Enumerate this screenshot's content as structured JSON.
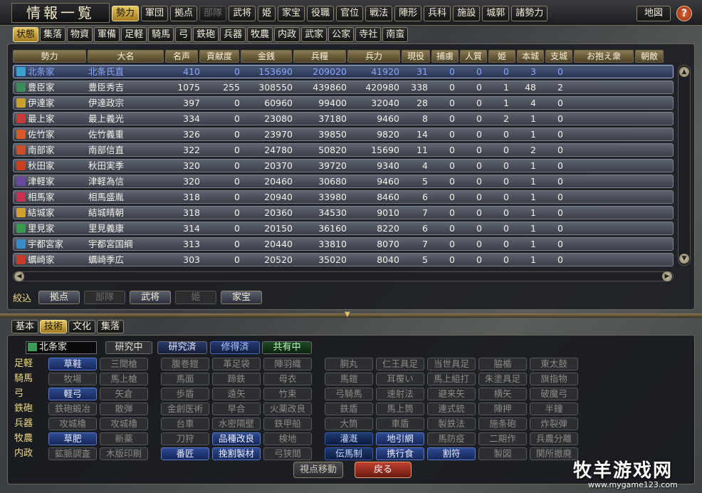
{
  "header": {
    "title": "情報一覧",
    "tabs": [
      "勢力",
      "軍団",
      "拠点",
      "部隊",
      "武将",
      "姫",
      "家宝",
      "役職",
      "官位",
      "戦法",
      "陣形",
      "兵科",
      "施設",
      "城郭",
      "諸勢力"
    ],
    "active_tab": "勢力",
    "disabled_tab": "部隊",
    "map_label": "地図",
    "help_label": "?"
  },
  "subtabs": [
    "状態",
    "集落",
    "物資",
    "軍備",
    "足軽",
    "騎馬",
    "弓",
    "鉄砲",
    "兵器",
    "牧農",
    "内政",
    "武家",
    "公家",
    "寺社",
    "南蛮"
  ],
  "columns": [
    "勢力",
    "大名",
    "名声",
    "貢献度",
    "金銭",
    "兵糧",
    "兵力",
    "現役",
    "捕虜",
    "人質",
    "姫",
    "本城",
    "支城",
    "お抱え衆",
    "朝敵"
  ],
  "rows": [
    [
      "北条家",
      "北条氏直",
      "410",
      "0",
      "153690",
      "209020",
      "41920",
      "31",
      "0",
      "0",
      "0",
      "3",
      "0"
    ],
    [
      "豊臣家",
      "豊臣秀吉",
      "1075",
      "255",
      "308550",
      "439860",
      "420980",
      "338",
      "0",
      "0",
      "1",
      "48",
      "2"
    ],
    [
      "伊達家",
      "伊達政宗",
      "397",
      "0",
      "60960",
      "99400",
      "32040",
      "28",
      "0",
      "0",
      "1",
      "4",
      "0"
    ],
    [
      "最上家",
      "最上義光",
      "334",
      "0",
      "23080",
      "37180",
      "9460",
      "8",
      "0",
      "0",
      "2",
      "1",
      "0"
    ],
    [
      "佐竹家",
      "佐竹義重",
      "326",
      "0",
      "23970",
      "39850",
      "9820",
      "14",
      "0",
      "0",
      "0",
      "1",
      "0"
    ],
    [
      "南部家",
      "南部信直",
      "322",
      "0",
      "24780",
      "50820",
      "15690",
      "11",
      "0",
      "0",
      "0",
      "2",
      "0"
    ],
    [
      "秋田家",
      "秋田実季",
      "320",
      "0",
      "20370",
      "39720",
      "9340",
      "4",
      "0",
      "0",
      "0",
      "1",
      "0"
    ],
    [
      "津軽家",
      "津軽為信",
      "320",
      "0",
      "20460",
      "30680",
      "9460",
      "5",
      "0",
      "0",
      "0",
      "1",
      "0"
    ],
    [
      "相馬家",
      "相馬盛胤",
      "318",
      "0",
      "20940",
      "33980",
      "8460",
      "6",
      "0",
      "0",
      "0",
      "1",
      "0"
    ],
    [
      "結城家",
      "結城晴朝",
      "318",
      "0",
      "20360",
      "34530",
      "9010",
      "7",
      "0",
      "0",
      "0",
      "1",
      "0"
    ],
    [
      "里見家",
      "里見義康",
      "314",
      "0",
      "20150",
      "36160",
      "8220",
      "6",
      "0",
      "0",
      "0",
      "1",
      "0"
    ],
    [
      "宇都宮家",
      "宇都宮国綱",
      "313",
      "0",
      "20440",
      "33810",
      "8070",
      "7",
      "0",
      "0",
      "0",
      "1",
      "0"
    ],
    [
      "蠣崎家",
      "蠣崎季広",
      "303",
      "0",
      "20520",
      "35020",
      "8040",
      "5",
      "0",
      "0",
      "0",
      "1",
      "0"
    ]
  ],
  "row_colors": [
    "#3aa0d0",
    "#3a8a5a",
    "#c8a030",
    "#c83a3a",
    "#d85a2a",
    "#c8502a",
    "#c84020",
    "#6a4aa0",
    "#c83050",
    "#d0a030",
    "#3a9a50",
    "#3a8ac8",
    "#c83a2a"
  ],
  "filter": {
    "label": "絞込",
    "buttons": [
      "拠点",
      "部隊",
      "武将",
      "姫",
      "家宝"
    ],
    "disabled": [
      "部隊",
      "姫"
    ]
  },
  "tech_tabs": [
    "基本",
    "技術",
    "文化",
    "集落"
  ],
  "tech_active": "技術",
  "tech_clan": "北条家",
  "legend": [
    "研究中",
    "研究済",
    "修得済",
    "共有中"
  ],
  "categories": [
    "足軽",
    "騎馬",
    "弓",
    "鉄砲",
    "兵器",
    "牧農",
    "内政"
  ],
  "techs": [
    [
      [
        "草鞋",
        "acq"
      ],
      [
        "三間槍",
        ""
      ],
      [
        "腹巻鎧",
        ""
      ],
      [
        "革足袋",
        ""
      ],
      [
        "陣羽織",
        ""
      ],
      [
        "胴丸",
        ""
      ],
      [
        "仁王具足",
        ""
      ],
      [
        "当世具足",
        ""
      ],
      [
        "脇楯",
        ""
      ],
      [
        "東太鼓",
        ""
      ]
    ],
    [
      [
        "牧場",
        ""
      ],
      [
        "馬上槍",
        ""
      ],
      [
        "馬面",
        ""
      ],
      [
        "蹄鉄",
        ""
      ],
      [
        "母衣",
        ""
      ],
      [
        "馬鎧",
        ""
      ],
      [
        "耳覆い",
        ""
      ],
      [
        "馬上組打",
        ""
      ],
      [
        "朱塗具足",
        ""
      ],
      [
        "旗指物",
        ""
      ]
    ],
    [
      [
        "軽弓",
        "acq"
      ],
      [
        "矢倉",
        ""
      ],
      [
        "歩盾",
        ""
      ],
      [
        "遠矢",
        ""
      ],
      [
        "竹束",
        ""
      ],
      [
        "弓騎馬",
        ""
      ],
      [
        "速射法",
        ""
      ],
      [
        "避来矢",
        ""
      ],
      [
        "横矢",
        ""
      ],
      [
        "破魔弓",
        ""
      ]
    ],
    [
      [
        "鉄砲鍛冶",
        ""
      ],
      [
        "散弾",
        ""
      ],
      [
        "金創医術",
        ""
      ],
      [
        "早合",
        ""
      ],
      [
        "火薬改良",
        ""
      ],
      [
        "鉄盾",
        ""
      ],
      [
        "馬上筒",
        ""
      ],
      [
        "連式銃",
        ""
      ],
      [
        "陣押",
        ""
      ],
      [
        "半鐘",
        ""
      ]
    ],
    [
      [
        "攻城櫓",
        ""
      ],
      [
        "攻城櫓",
        ""
      ],
      [
        "台車",
        ""
      ],
      [
        "水密隔壁",
        ""
      ],
      [
        "鉄甲船",
        ""
      ],
      [
        "大筒",
        ""
      ],
      [
        "車盾",
        ""
      ],
      [
        "製鉄法",
        ""
      ],
      [
        "施条砲",
        ""
      ],
      [
        "炸裂弾",
        ""
      ]
    ],
    [
      [
        "草肥",
        "acq"
      ],
      [
        "新薬",
        ""
      ],
      [
        "刀狩",
        ""
      ],
      [
        "品種改良",
        "acq"
      ],
      [
        "検地",
        ""
      ],
      [
        "灌漑",
        "shr"
      ],
      [
        "地引網",
        "acq"
      ],
      [
        "馬防疫",
        ""
      ],
      [
        "二期作",
        ""
      ],
      [
        "兵農分離",
        ""
      ]
    ],
    [
      [
        "鉱脈調査",
        ""
      ],
      [
        "木版印刷",
        ""
      ],
      [
        "番匠",
        "acq"
      ],
      [
        "挽割製材",
        "acq"
      ],
      [
        "弓狭間",
        ""
      ],
      [
        "伝馬制",
        "shr"
      ],
      [
        "携行食",
        "acq"
      ],
      [
        "割符",
        "acq"
      ],
      [
        "製図",
        ""
      ],
      [
        "関所撤廃",
        ""
      ]
    ]
  ],
  "buttons": {
    "viewpoint": "視点移動",
    "back": "戻る"
  },
  "watermark": {
    "text": "牧羊游戏网",
    "url": "www.mygame123.com"
  }
}
